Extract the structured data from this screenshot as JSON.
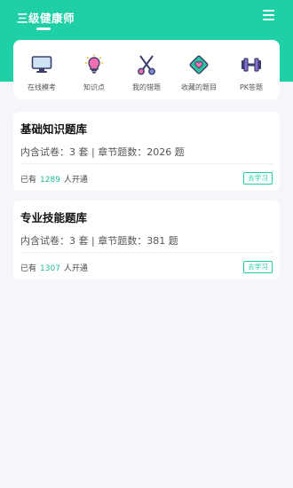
{
  "header": {
    "title": "三级健康师"
  },
  "shortcuts": [
    {
      "label": "在线模考",
      "icon": "monitor-icon"
    },
    {
      "label": "知识点",
      "icon": "lightbulb-icon"
    },
    {
      "label": "我的错题",
      "icon": "scissors-icon"
    },
    {
      "label": "收藏的题目",
      "icon": "heart-diamond-icon"
    },
    {
      "label": "PK答题",
      "icon": "dumbbell-icon"
    }
  ],
  "banks": [
    {
      "title": "基础知识题库",
      "desc": "内含试卷：3 套 | 章节题数：2026 题",
      "joined_prefix": "已有",
      "joined_count": "1289",
      "joined_suffix": "人开通",
      "action": "去学习"
    },
    {
      "title": "专业技能题库",
      "desc": "内含试卷：3 套 | 章节题数：381 题",
      "joined_prefix": "已有",
      "joined_count": "1307",
      "joined_suffix": "人开通",
      "action": "去学习"
    }
  ],
  "colors": {
    "accent": "#1fcfa6",
    "background": "#f5f5fa"
  }
}
